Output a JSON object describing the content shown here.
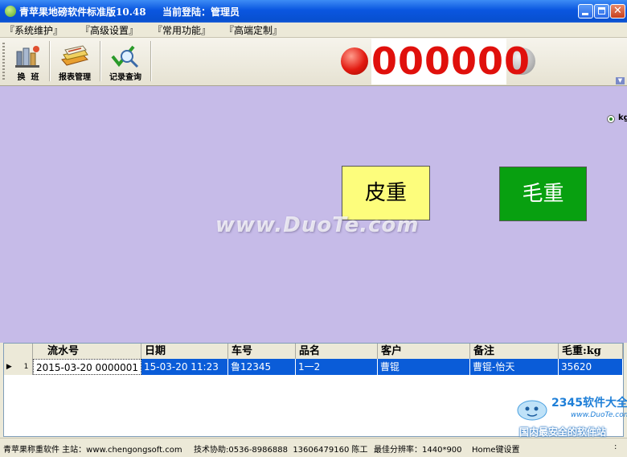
{
  "window": {
    "title": "青苹果地磅软件标准版10.48",
    "login": "当前登陆：管理员"
  },
  "menu": [
    "『系统维护』",
    "『高级设置』",
    "『常用功能』",
    "『高端定制』"
  ],
  "toolbar": {
    "tools": [
      {
        "label": "换  班",
        "icon": "shift-change-icon"
      },
      {
        "label": "报表管理",
        "icon": "report-books-icon"
      },
      {
        "label": "记录查询",
        "icon": "record-search-icon"
      }
    ],
    "weight_display": "000000",
    "lamp_left_color": "#e21a10",
    "lamp_right_color": "#b8b8b8"
  },
  "main": {
    "unit_label": "kg",
    "tare_button": "皮重",
    "gross_button": "毛重",
    "watermark": "www.DuoTe.com",
    "background": "#c6bbe8"
  },
  "grid": {
    "columns": [
      "流水号",
      "日期",
      "车号",
      "品名",
      "客户",
      "备注",
      "毛重:kg"
    ],
    "rows": [
      {
        "index": "1",
        "cells": [
          "2015-03-20 0000001",
          "15-03-20 11:23",
          "鲁12345",
          "1一2",
          "曹锟",
          "曹锟-怡天",
          "35620"
        ]
      }
    ]
  },
  "logo": {
    "brand": "2345软件大全",
    "site": "www.DuoTe.com",
    "slogan": "国内最安全的软件站"
  },
  "status": {
    "app": "青苹果称重软件 主站：www.chengongsoft.com",
    "support": "技术协助:0536-8986888  13606479160 陈工",
    "resolution": "最佳分辨率：1440*900",
    "home_key": "Home键设置",
    "indicator": ":"
  }
}
